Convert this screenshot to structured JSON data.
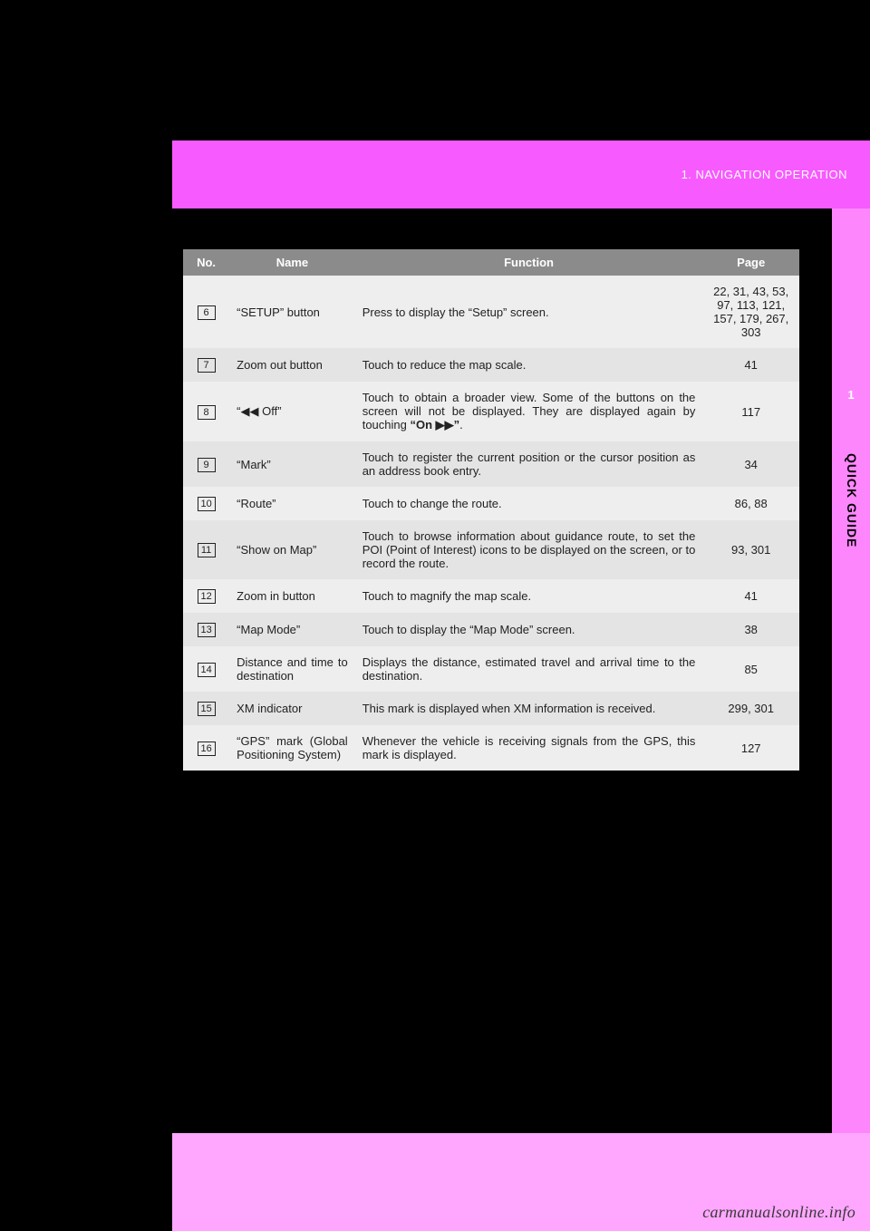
{
  "header": {
    "section_label": "1. NAVIGATION OPERATION"
  },
  "side": {
    "tab_number": "1",
    "tab_title": "QUICK GUIDE"
  },
  "table": {
    "headers": {
      "no": "No.",
      "name": "Name",
      "function": "Function",
      "page": "Page"
    },
    "rows": [
      {
        "no": "6",
        "name": "“SETUP” button",
        "function": "Press to display the “Setup” screen.",
        "page": "22, 31, 43, 53, 97, 113, 121, 157, 179, 267, 303"
      },
      {
        "no": "7",
        "name": "Zoom out button",
        "function": "Touch to reduce the map scale.",
        "page": "41"
      },
      {
        "no": "8",
        "name": "“◀◀ Off”",
        "function_html": "Touch to obtain a broader view. Some of the buttons on the screen will not be displayed. They are displayed again by touching <b>“On ▶▶”</b>.",
        "page": "117"
      },
      {
        "no": "9",
        "name": "“Mark”",
        "function": "Touch to register the current position or the cursor position as an address book entry.",
        "page": "34"
      },
      {
        "no": "10",
        "name": "“Route”",
        "function": "Touch to change the route.",
        "page": "86, 88"
      },
      {
        "no": "11",
        "name": "“Show on Map”",
        "function": "Touch to browse information about guidance route, to set the POI (Point of Interest) icons to be displayed on the screen, or to record the route.",
        "page": "93, 301"
      },
      {
        "no": "12",
        "name": "Zoom in button",
        "function": "Touch to magnify the map scale.",
        "page": "41"
      },
      {
        "no": "13",
        "name": "“Map Mode”",
        "function": "Touch to display the “Map Mode” screen.",
        "page": "38"
      },
      {
        "no": "14",
        "name": "Distance and time to destination",
        "function": "Displays the distance, estimated travel and arrival time to the destination.",
        "page": "85"
      },
      {
        "no": "15",
        "name": "XM indicator",
        "function": "This mark is displayed when XM information is received.",
        "page": "299, 301"
      },
      {
        "no": "16",
        "name": "“GPS” mark (Global Positioning System)",
        "function": "Whenever the vehicle is receiving signals from the GPS, this mark is displayed.",
        "page": "127"
      }
    ]
  },
  "watermark": "carmanualsonline.info"
}
